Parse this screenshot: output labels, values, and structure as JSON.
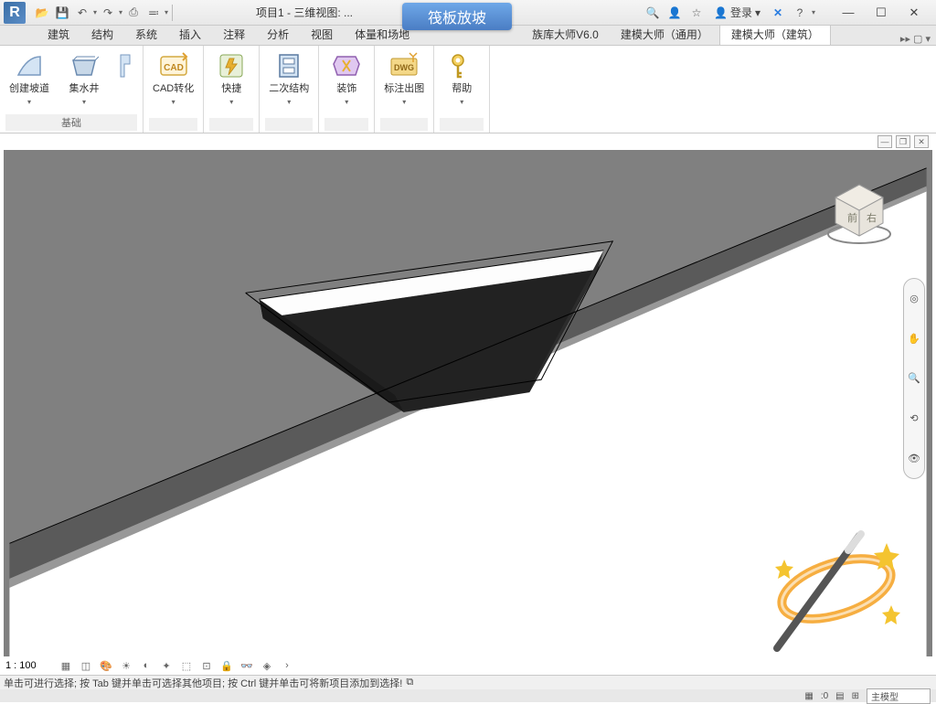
{
  "title_prefix": "项目1 - 三维视图: ...",
  "feature_name": "筏板放坡",
  "login_label": "登录",
  "menu_tabs": [
    "建筑",
    "结构",
    "系统",
    "插入",
    "注释",
    "分析",
    "视图",
    "体量和场地"
  ],
  "menu_tabs_right": [
    "族库大师V6.0",
    "建模大师（通用）",
    "建模大师（建筑）"
  ],
  "ribbon": {
    "panel1_label": "基础",
    "btn_ramp": "创建坡道",
    "btn_sump": "集水井",
    "btn_cad": "CAD转化",
    "btn_quick": "快捷",
    "btn_secondary": "二次结构",
    "btn_decor": "装饰",
    "btn_annot": "标注出图",
    "btn_help": "帮助"
  },
  "view_scale": "1 : 100",
  "status_hint": "单击可进行选择; 按 Tab 键并单击可选择其他项目; 按 Ctrl 键并单击可将新项目添加到选择!",
  "status_count": ":0",
  "selector_label": "主模型",
  "viewcube_face": "前 右"
}
